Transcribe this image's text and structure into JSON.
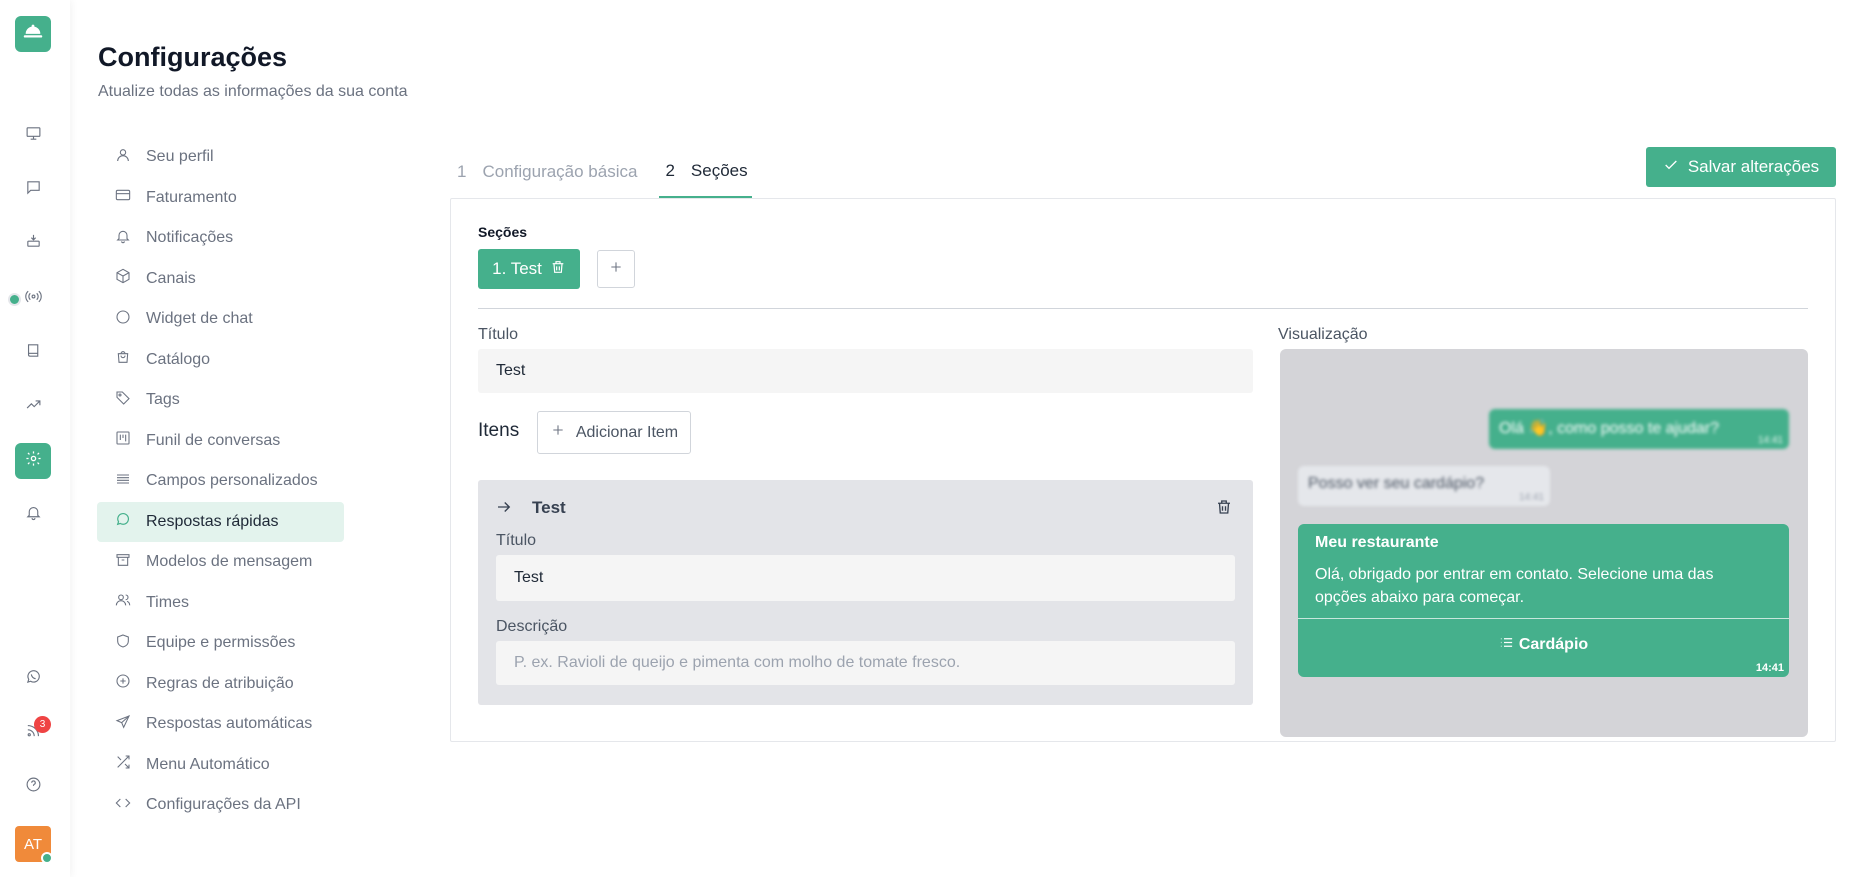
{
  "rail": {
    "items": [
      {
        "icon": "monitor-icon"
      },
      {
        "icon": "chat-icon"
      },
      {
        "icon": "inbox-icon"
      },
      {
        "icon": "broadcast-icon"
      },
      {
        "icon": "book-icon"
      },
      {
        "icon": "trending-icon"
      },
      {
        "icon": "gear-icon",
        "active": true
      },
      {
        "icon": "bell-icon"
      },
      {
        "icon": "whatsapp-icon"
      },
      {
        "icon": "feed-icon"
      },
      {
        "icon": "help-icon"
      }
    ],
    "feed_badge": "3",
    "avatar_initials": "AT"
  },
  "header": {
    "title": "Configurações",
    "subtitle": "Atualize todas as informações da sua conta"
  },
  "settings_nav": [
    {
      "label": "Seu perfil",
      "icon": "user-icon"
    },
    {
      "label": "Faturamento",
      "icon": "credit-card-icon"
    },
    {
      "label": "Notificações",
      "icon": "bell-icon"
    },
    {
      "label": "Canais",
      "icon": "box-icon"
    },
    {
      "label": "Widget de chat",
      "icon": "circle-icon"
    },
    {
      "label": "Catálogo",
      "icon": "shopping-bag-icon"
    },
    {
      "label": "Tags",
      "icon": "tag-icon"
    },
    {
      "label": "Funil de conversas",
      "icon": "kanban-icon"
    },
    {
      "label": "Campos personalizados",
      "icon": "lines-icon"
    },
    {
      "label": "Respostas rápidas",
      "icon": "message-circle-icon",
      "active": true
    },
    {
      "label": "Modelos de mensagem",
      "icon": "archive-icon"
    },
    {
      "label": "Times",
      "icon": "users-icon"
    },
    {
      "label": "Equipe e permissões",
      "icon": "shield-icon"
    },
    {
      "label": "Regras de atribuição",
      "icon": "plus-circle-icon"
    },
    {
      "label": "Respostas automáticas",
      "icon": "send-icon"
    },
    {
      "label": "Menu Automático",
      "icon": "shuffle-icon"
    },
    {
      "label": "Configurações da API",
      "icon": "code-icon"
    }
  ],
  "tabs": [
    {
      "num": "1",
      "label": "Configuração básica"
    },
    {
      "num": "2",
      "label": "Seções",
      "active": true
    }
  ],
  "save_button": "Salvar alterações",
  "sections": {
    "label": "Seções",
    "chip_label": "1. Test"
  },
  "section_form": {
    "title_label": "Título",
    "title_value": "Test",
    "items_label": "Itens",
    "add_item_label": "Adicionar Item"
  },
  "item": {
    "name": "Test",
    "title_label": "Título",
    "title_value": "Test",
    "description_label": "Descrição",
    "description_placeholder": "P. ex. Ravioli de queijo e pimenta com molho de tomate fresco."
  },
  "preview": {
    "label": "Visualização",
    "outgoing_text": "Olá 👋, como posso te ajudar?",
    "outgoing_time": "14:41",
    "incoming_text": "Posso ver seu cardápio?",
    "incoming_time": "14:41",
    "menu_title": "Meu restaurante",
    "menu_body": "Olá, obrigado por entrar em contato. Selecione uma das opções abaixo para começar.",
    "menu_button": "Cardápio",
    "menu_time": "14:41"
  },
  "colors": {
    "accent": "#45b08c",
    "accent_light": "#e3f3ed",
    "badge": "#ef4444",
    "avatar": "#f08a3a"
  }
}
